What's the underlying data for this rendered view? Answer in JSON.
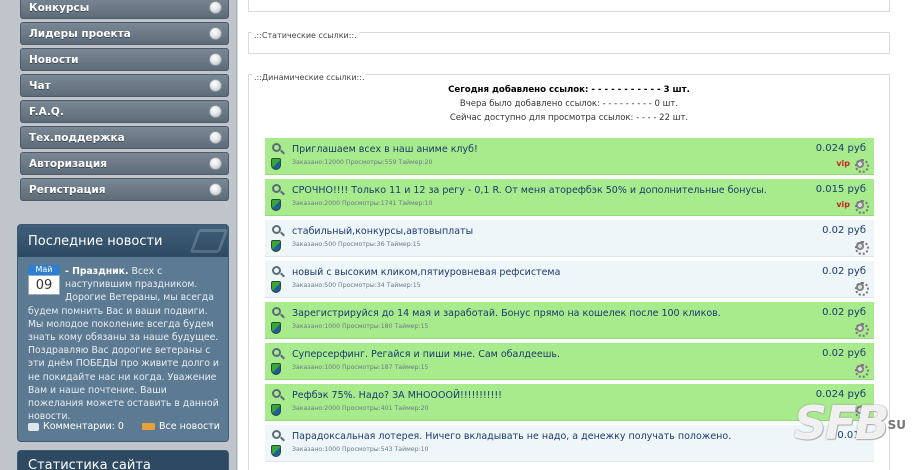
{
  "menu": [
    {
      "label": "Конкурсы"
    },
    {
      "label": "Лидеры проекта"
    },
    {
      "label": "Новости"
    },
    {
      "label": "Чат"
    },
    {
      "label": "F.A.Q."
    },
    {
      "label": "Тех.поддержка"
    },
    {
      "label": "Авторизация"
    },
    {
      "label": "Регистрация"
    }
  ],
  "news": {
    "title": "Последние новости",
    "month": "Май",
    "day": "09",
    "headline": "- Праздник.",
    "text": "Всех с наступившим праздником. Дорогие Ветераны, мы всегда будем помнить Вас и ваши подвиги. Мы молодое поколение всегда будем знать кому обязаны за наше будущее. Поздравляю Вас дорогие ветераны с эти днём ПОБЕДЫ про живите долго и не покидайте нас ни когда. Уважение Вам и наше почтение. Ваши пожелания можете оставить в данной новости.",
    "comments": "Комментарии: 0",
    "all_news": "Все новости"
  },
  "stats": {
    "title": "Статистика сайта"
  },
  "static_links": {
    "legend": ".::Статические ссылки::."
  },
  "dynamic_links": {
    "legend": ".::Динамические ссылки::.",
    "today": "Сегодня добавлено ссылок: - - - - - - - - - - - 3 шт.",
    "yesterday": "Вчера было добавлено ссылок: - - - - - - - - - 0 шт.",
    "available": "Сейчас доступно для просмотра ссылок: - - - - 22 шт."
  },
  "links": [
    {
      "title": "Приглашаем всех в наш аниме клуб!",
      "meta": "Заказано:12000 Просмотры:559 Таймер:20",
      "price": "0.024 руб",
      "vip": "vip",
      "style": "green"
    },
    {
      "title": "СРОЧНО!!!! Только 11 и 12 за регу - 0,1 R. От меня аторефбэк 50% и дополнительные бонусы.",
      "meta": "Заказано:2000 Просмотры:1741 Таймер:10",
      "price": "0.015 руб",
      "vip": "vip",
      "style": "green"
    },
    {
      "title": "стабильный,конкурсы,автовыплаты",
      "meta": "Заказано:500 Просмотры:36 Таймер:15",
      "price": "0.02 руб",
      "vip": "",
      "style": "plain"
    },
    {
      "title": "новый с высоким кликом,пятиуровневая рефсистема",
      "meta": "Заказано:500 Просмотры:34 Таймер:15",
      "price": "0.02 руб",
      "vip": "",
      "style": "plain"
    },
    {
      "title": "Зарегистрируйся до 14 мая и заработай. Бонус прямо на кошелек после 100 кликов.",
      "meta": "Заказано:1000 Просмотры:180 Таймер:15",
      "price": "0.02 руб",
      "vip": "",
      "style": "green"
    },
    {
      "title": "Суперсерфинг. Регайся и пиши мне. Сам обалдеешь.",
      "meta": "Заказано:1000 Просмотры:187 Таймер:15",
      "price": "0.02 руб",
      "vip": "",
      "style": "green"
    },
    {
      "title": "Рефбэк 75%. Надо? ЗА МНОООOЙ!!!!!!!!!!!",
      "meta": "Заказано:2000 Просмотры:401 Таймер:20",
      "price": "0.024 руб",
      "vip": "",
      "style": "green"
    },
    {
      "title": "Парадоксальная лотерея. Ничего вкладывать не надо, а денежку получать положено.",
      "meta": "Заказано:1000 Просмотры:543 Таймер:10",
      "price": "0.015",
      "vip": "",
      "style": "plain"
    }
  ],
  "watermark": {
    "logo": "SFB",
    "suffix": "SU"
  }
}
